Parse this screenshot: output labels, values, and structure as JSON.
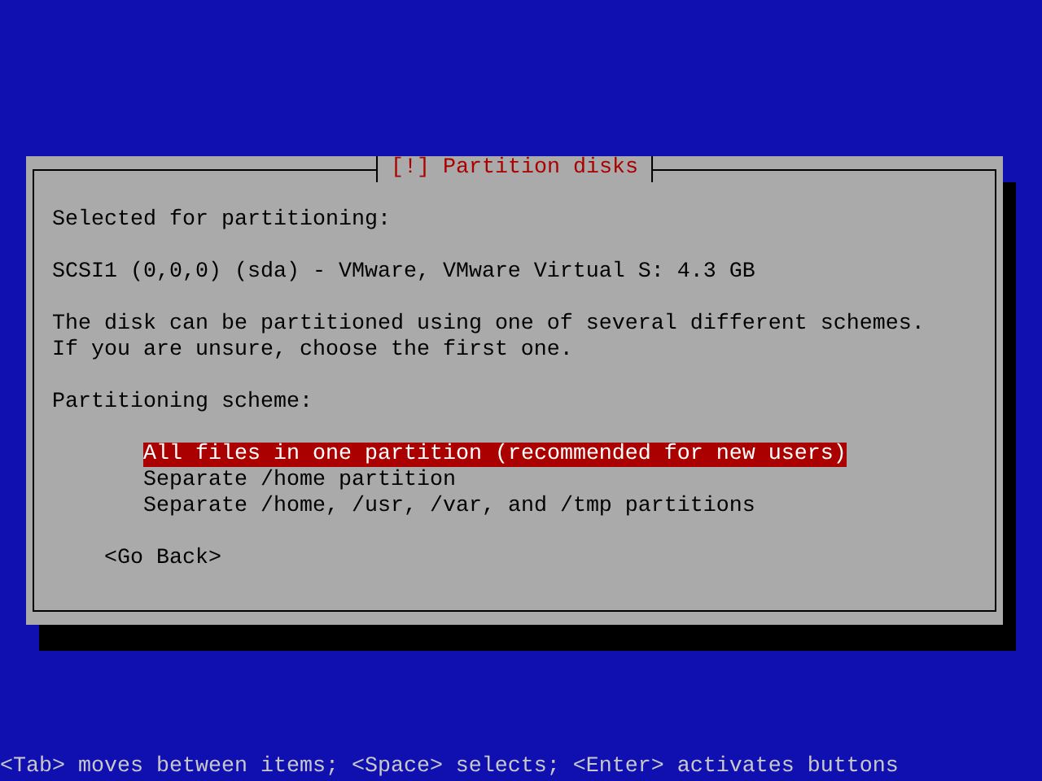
{
  "dialog": {
    "title": "[!] Partition disks",
    "lines": [
      "Selected for partitioning:",
      "SCSI1 (0,0,0) (sda) - VMware, VMware Virtual S: 4.3 GB"
    ],
    "description": [
      "The disk can be partitioned using one of several different schemes.",
      "If you are unsure, choose the first one."
    ],
    "list_label": "Partitioning scheme:",
    "options": [
      {
        "label": "All files in one partition (recommended for new users)",
        "selected": true
      },
      {
        "label": "Separate /home partition",
        "selected": false
      },
      {
        "label": "Separate /home, /usr, /var, and /tmp partitions",
        "selected": false
      }
    ],
    "buttons": [
      "<Go Back>"
    ]
  },
  "help_line": "<Tab> moves between items; <Space> selects; <Enter> activates buttons"
}
